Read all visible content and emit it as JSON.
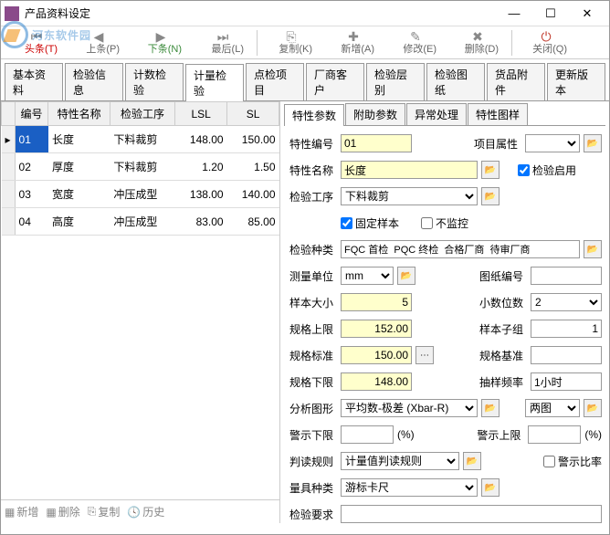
{
  "window": {
    "title": "产品资料设定"
  },
  "watermark": "河东软件园",
  "toolbar": {
    "first": "头条(T)",
    "prev": "上条(P)",
    "next": "下条(N)",
    "last": "最后(L)",
    "copy": "复制(K)",
    "add": "新增(A)",
    "edit": "修改(E)",
    "delete": "删除(D)",
    "close": "关闭(Q)"
  },
  "tabs": [
    "基本资料",
    "检验信息",
    "计数检验",
    "计量检验",
    "点检项目",
    "厂商客户",
    "检验层别",
    "检验图纸",
    "货品附件",
    "更新版本"
  ],
  "active_tab": 3,
  "grid": {
    "headers": [
      "编号",
      "特性名称",
      "检验工序",
      "LSL",
      "SL"
    ],
    "rows": [
      {
        "id": "01",
        "name": "长度",
        "proc": "下料裁剪",
        "lsl": "148.00",
        "sl": "150.00",
        "selected": true
      },
      {
        "id": "02",
        "name": "厚度",
        "proc": "下料裁剪",
        "lsl": "1.20",
        "sl": "1.50"
      },
      {
        "id": "03",
        "name": "宽度",
        "proc": "冲压成型",
        "lsl": "138.00",
        "sl": "140.00"
      },
      {
        "id": "04",
        "name": "高度",
        "proc": "冲压成型",
        "lsl": "83.00",
        "sl": "85.00"
      }
    ]
  },
  "leftbar": {
    "add": "新增",
    "delete": "删除",
    "copy": "复制",
    "history": "历史"
  },
  "rtabs": [
    "特性参数",
    "附助参数",
    "异常处理",
    "特性图样"
  ],
  "form": {
    "feat_no_lbl": "特性编号",
    "feat_no": "01",
    "proj_attr_lbl": "项目属性",
    "proj_attr": "",
    "feat_name_lbl": "特性名称",
    "feat_name": "长度",
    "enable_lbl": "检验启用",
    "enable": true,
    "proc_lbl": "检验工序",
    "proc": "下料裁剪",
    "fixed_lbl": "固定样本",
    "fixed": true,
    "nomon_lbl": "不监控",
    "nomon": false,
    "kind_lbl": "检验种类",
    "kind": "FQC 首检  PQC 终检  合格厂商  待审厂商",
    "unit_lbl": "测量单位",
    "unit": "mm",
    "draw_lbl": "图纸编号",
    "draw": "",
    "sample_lbl": "样本大小",
    "sample": "5",
    "dec_lbl": "小数位数",
    "dec": "2",
    "usl_lbl": "规格上限",
    "usl": "152.00",
    "subgroup_lbl": "样本子组",
    "subgroup": "1",
    "std_lbl": "规格标准",
    "std": "150.00",
    "base_lbl": "规格基准",
    "base": "",
    "lsl_lbl": "规格下限",
    "lsl": "148.00",
    "freq_lbl": "抽样频率",
    "freq": "1小时",
    "chart_lbl": "分析图形",
    "chart": "平均数-极差 (Xbar-R)",
    "chart2": "两图",
    "warn_lo_lbl": "警示下限",
    "warn_lo": "",
    "pct": "(%)",
    "warn_hi_lbl": "警示上限",
    "warn_hi": "",
    "rule_lbl": "判读规则",
    "rule": "计量值判读规则",
    "warn_rate_lbl": "警示比率",
    "gauge_lbl": "量具种类",
    "gauge": "游标卡尺",
    "req_lbl": "检验要求",
    "req": ""
  }
}
